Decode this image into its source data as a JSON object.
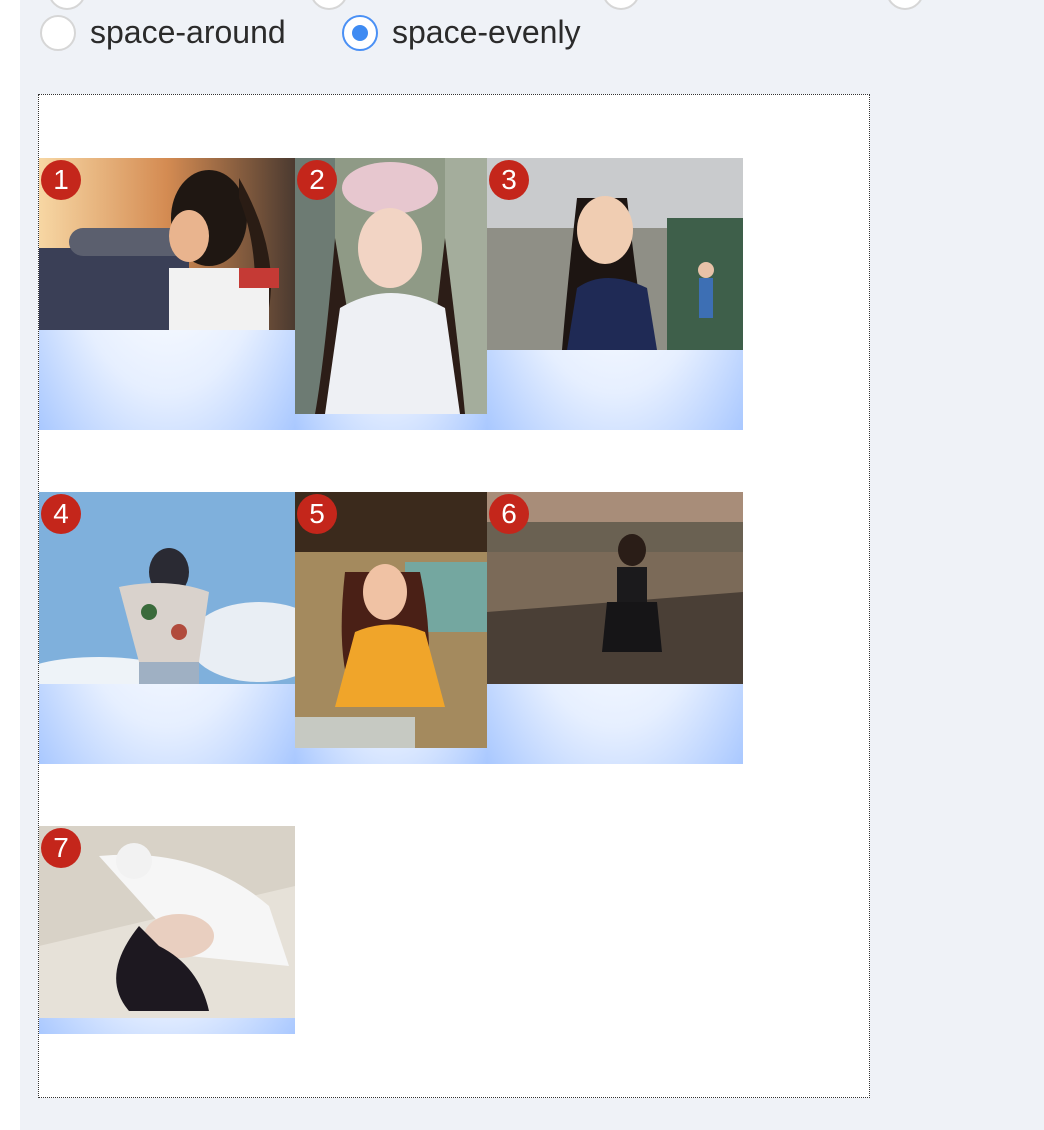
{
  "radios": [
    {
      "label": "space-around",
      "checked": false
    },
    {
      "label": "space-evenly",
      "checked": true
    }
  ],
  "items": [
    {
      "number": "1",
      "scene": "girl-with-ponytail-sunset"
    },
    {
      "number": "2",
      "scene": "girl-in-beret-white-sweater"
    },
    {
      "number": "3",
      "scene": "girl-by-river"
    },
    {
      "number": "4",
      "scene": "girl-blue-sky-floral-shirt"
    },
    {
      "number": "5",
      "scene": "girl-orange-dress-grass"
    },
    {
      "number": "6",
      "scene": "girl-in-field-of-reeds"
    },
    {
      "number": "7",
      "scene": "girl-lying-on-fur"
    }
  ],
  "colors": {
    "badge": "#c4261b",
    "radio_accent": "#3f8bf2",
    "panel_bg": "#eff2f7"
  }
}
